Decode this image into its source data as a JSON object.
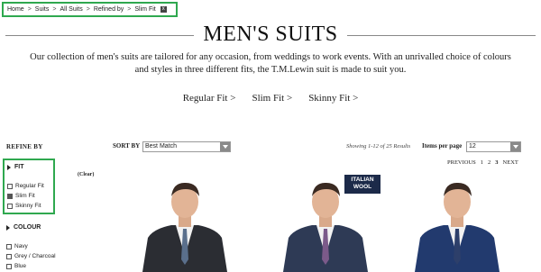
{
  "breadcrumb": {
    "items": [
      "Home",
      "Suits",
      "All Suits",
      "Refined by",
      "Slim Fit"
    ],
    "separator": ">",
    "remove_label": "x"
  },
  "page": {
    "title": "MEN'S SUITS",
    "intro": "Our collection of men's suits are tailored for any occasion, from weddings to work events. With an unrivalled choice of colours and styles in three different fits, the T.M.Lewin suit is made to suit you."
  },
  "fit_links": [
    "Regular Fit >",
    "Slim Fit >",
    "Skinny Fit >"
  ],
  "toolbar": {
    "refine_by": "REFINE BY",
    "sort_by_label": "SORT BY",
    "sort_value": "Best Match",
    "showing": "Showing 1-12 of 25 Results",
    "per_page_label": "Items per page",
    "per_page_value": "12",
    "pagination": {
      "previous": "PREVIOUS",
      "pages": [
        "1",
        "2",
        "3"
      ],
      "current": "3",
      "next": "NEXT"
    }
  },
  "filters": {
    "clear_label": "(Clear)",
    "fit": {
      "title": "FIT",
      "options": [
        {
          "label": "Regular Fit",
          "checked": false
        },
        {
          "label": "Slim Fit",
          "checked": true
        },
        {
          "label": "Skinny Fit",
          "checked": false
        }
      ]
    },
    "colour": {
      "title": "COLOUR",
      "options": [
        {
          "label": "Navy",
          "checked": false
        },
        {
          "label": "Grey / Charcoal",
          "checked": false
        },
        {
          "label": "Blue",
          "checked": false
        }
      ]
    }
  },
  "products": [
    {
      "suit_color": "#2b2d33",
      "tie_color": "#5a6f8c"
    },
    {
      "suit_color": "#2e3a55",
      "tie_color": "#7b5a8a",
      "badge": "ITALIAN WOOL"
    },
    {
      "suit_color": "#223a6e",
      "tie_color": "#2d3f6a"
    }
  ],
  "colors": {
    "highlight_border": "#2fa84f",
    "badge_bg": "#1c2a49"
  }
}
